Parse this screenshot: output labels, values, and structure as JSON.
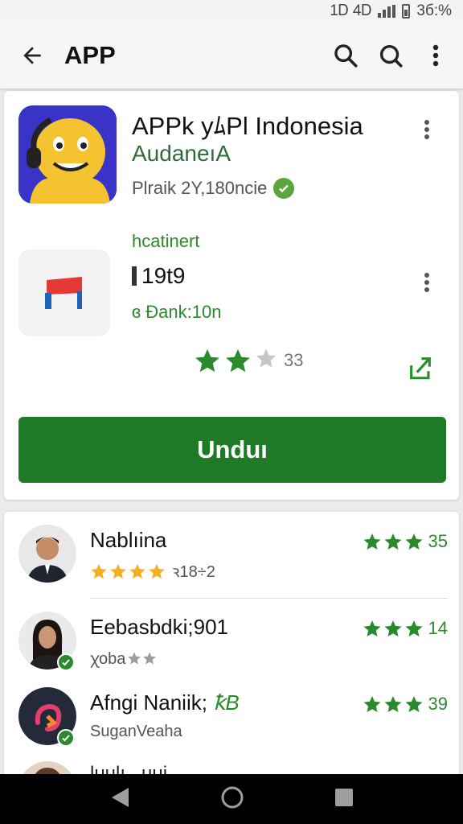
{
  "status_bar": {
    "network": "1Ꭰ 4Ꭰ",
    "battery": "3б:%"
  },
  "app_bar": {
    "title": "APP"
  },
  "app": {
    "name": "APPk yﾑPl Indonesia",
    "developer": "AudaneıA",
    "meta": "Plraik 2Y,180ncie"
  },
  "sub_item": {
    "label": "hcatinert",
    "size": "19t9",
    "downloads": "ɞ Ðank:10n"
  },
  "rating": {
    "filled": 2,
    "total": 3,
    "count": "33"
  },
  "install_button": "Unduı",
  "reviews": [
    {
      "name": "Nablıina",
      "subtitle": "ꝛ18÷2",
      "sub_stars": {
        "filled": 4,
        "total": 4,
        "color": "#f2b01e"
      },
      "right_stars": 3,
      "right_count": "35",
      "verified": false
    },
    {
      "name": "Eebasbdki;901",
      "subtitle": "ꭓoba",
      "sub_stars": {
        "filled": 0,
        "total": 2,
        "color": "#9e9e9e"
      },
      "right_stars": 3,
      "right_count": "14",
      "verified": true
    },
    {
      "name": "Afngi Naniik;",
      "name_suffix": "ꝁB",
      "subtitle": "SuganVeaha",
      "sub_stars": {
        "filled": 0,
        "total": 0,
        "color": "#9e9e9e"
      },
      "right_stars": 3,
      "right_count": "39",
      "verified": true
    }
  ],
  "peek_text": "luulı ..uui",
  "colors": {
    "accent": "#1e7a24",
    "star_green": "#2b8a2b",
    "star_gold": "#f2b01e",
    "icon_bg": "#3a33c8"
  },
  "icons": [
    "back-arrow-icon",
    "search-icon",
    "more-vert-icon",
    "verified-check-icon",
    "share-icon",
    "star-icon",
    "nav-back-icon",
    "nav-home-icon",
    "nav-recents-icon"
  ]
}
